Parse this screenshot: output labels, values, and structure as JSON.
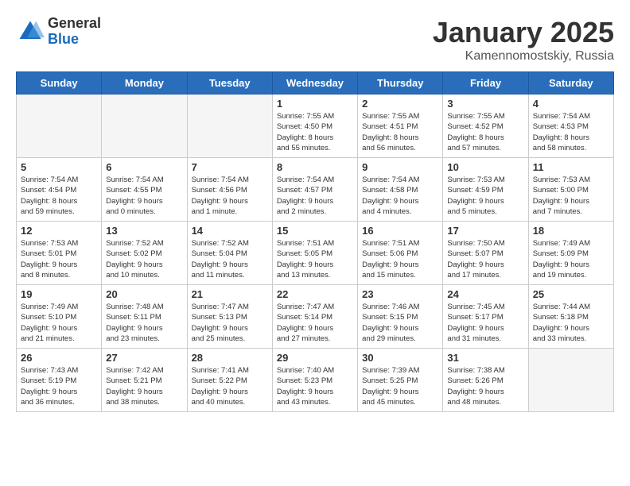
{
  "header": {
    "logo_general": "General",
    "logo_blue": "Blue",
    "title": "January 2025",
    "subtitle": "Kamennomostskiy, Russia"
  },
  "weekdays": [
    "Sunday",
    "Monday",
    "Tuesday",
    "Wednesday",
    "Thursday",
    "Friday",
    "Saturday"
  ],
  "weeks": [
    [
      {
        "day": "",
        "info": ""
      },
      {
        "day": "",
        "info": ""
      },
      {
        "day": "",
        "info": ""
      },
      {
        "day": "1",
        "info": "Sunrise: 7:55 AM\nSunset: 4:50 PM\nDaylight: 8 hours\nand 55 minutes."
      },
      {
        "day": "2",
        "info": "Sunrise: 7:55 AM\nSunset: 4:51 PM\nDaylight: 8 hours\nand 56 minutes."
      },
      {
        "day": "3",
        "info": "Sunrise: 7:55 AM\nSunset: 4:52 PM\nDaylight: 8 hours\nand 57 minutes."
      },
      {
        "day": "4",
        "info": "Sunrise: 7:54 AM\nSunset: 4:53 PM\nDaylight: 8 hours\nand 58 minutes."
      }
    ],
    [
      {
        "day": "5",
        "info": "Sunrise: 7:54 AM\nSunset: 4:54 PM\nDaylight: 8 hours\nand 59 minutes."
      },
      {
        "day": "6",
        "info": "Sunrise: 7:54 AM\nSunset: 4:55 PM\nDaylight: 9 hours\nand 0 minutes."
      },
      {
        "day": "7",
        "info": "Sunrise: 7:54 AM\nSunset: 4:56 PM\nDaylight: 9 hours\nand 1 minute."
      },
      {
        "day": "8",
        "info": "Sunrise: 7:54 AM\nSunset: 4:57 PM\nDaylight: 9 hours\nand 2 minutes."
      },
      {
        "day": "9",
        "info": "Sunrise: 7:54 AM\nSunset: 4:58 PM\nDaylight: 9 hours\nand 4 minutes."
      },
      {
        "day": "10",
        "info": "Sunrise: 7:53 AM\nSunset: 4:59 PM\nDaylight: 9 hours\nand 5 minutes."
      },
      {
        "day": "11",
        "info": "Sunrise: 7:53 AM\nSunset: 5:00 PM\nDaylight: 9 hours\nand 7 minutes."
      }
    ],
    [
      {
        "day": "12",
        "info": "Sunrise: 7:53 AM\nSunset: 5:01 PM\nDaylight: 9 hours\nand 8 minutes."
      },
      {
        "day": "13",
        "info": "Sunrise: 7:52 AM\nSunset: 5:02 PM\nDaylight: 9 hours\nand 10 minutes."
      },
      {
        "day": "14",
        "info": "Sunrise: 7:52 AM\nSunset: 5:04 PM\nDaylight: 9 hours\nand 11 minutes."
      },
      {
        "day": "15",
        "info": "Sunrise: 7:51 AM\nSunset: 5:05 PM\nDaylight: 9 hours\nand 13 minutes."
      },
      {
        "day": "16",
        "info": "Sunrise: 7:51 AM\nSunset: 5:06 PM\nDaylight: 9 hours\nand 15 minutes."
      },
      {
        "day": "17",
        "info": "Sunrise: 7:50 AM\nSunset: 5:07 PM\nDaylight: 9 hours\nand 17 minutes."
      },
      {
        "day": "18",
        "info": "Sunrise: 7:49 AM\nSunset: 5:09 PM\nDaylight: 9 hours\nand 19 minutes."
      }
    ],
    [
      {
        "day": "19",
        "info": "Sunrise: 7:49 AM\nSunset: 5:10 PM\nDaylight: 9 hours\nand 21 minutes."
      },
      {
        "day": "20",
        "info": "Sunrise: 7:48 AM\nSunset: 5:11 PM\nDaylight: 9 hours\nand 23 minutes."
      },
      {
        "day": "21",
        "info": "Sunrise: 7:47 AM\nSunset: 5:13 PM\nDaylight: 9 hours\nand 25 minutes."
      },
      {
        "day": "22",
        "info": "Sunrise: 7:47 AM\nSunset: 5:14 PM\nDaylight: 9 hours\nand 27 minutes."
      },
      {
        "day": "23",
        "info": "Sunrise: 7:46 AM\nSunset: 5:15 PM\nDaylight: 9 hours\nand 29 minutes."
      },
      {
        "day": "24",
        "info": "Sunrise: 7:45 AM\nSunset: 5:17 PM\nDaylight: 9 hours\nand 31 minutes."
      },
      {
        "day": "25",
        "info": "Sunrise: 7:44 AM\nSunset: 5:18 PM\nDaylight: 9 hours\nand 33 minutes."
      }
    ],
    [
      {
        "day": "26",
        "info": "Sunrise: 7:43 AM\nSunset: 5:19 PM\nDaylight: 9 hours\nand 36 minutes."
      },
      {
        "day": "27",
        "info": "Sunrise: 7:42 AM\nSunset: 5:21 PM\nDaylight: 9 hours\nand 38 minutes."
      },
      {
        "day": "28",
        "info": "Sunrise: 7:41 AM\nSunset: 5:22 PM\nDaylight: 9 hours\nand 40 minutes."
      },
      {
        "day": "29",
        "info": "Sunrise: 7:40 AM\nSunset: 5:23 PM\nDaylight: 9 hours\nand 43 minutes."
      },
      {
        "day": "30",
        "info": "Sunrise: 7:39 AM\nSunset: 5:25 PM\nDaylight: 9 hours\nand 45 minutes."
      },
      {
        "day": "31",
        "info": "Sunrise: 7:38 AM\nSunset: 5:26 PM\nDaylight: 9 hours\nand 48 minutes."
      },
      {
        "day": "",
        "info": ""
      }
    ]
  ]
}
